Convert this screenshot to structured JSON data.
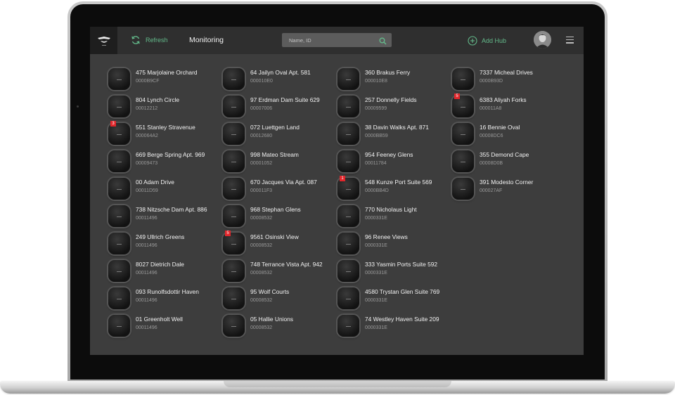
{
  "topbar": {
    "refresh_label": "Refresh",
    "title": "Monitoring",
    "search_placeholder": "Name, ID",
    "add_hub_label": "Add Hub"
  },
  "colors": {
    "accent": "#63b98a",
    "background": "#3d3d3d",
    "topbar": "#2f2f2f",
    "badge": "#e0262b"
  },
  "icons": [
    "logo-icon",
    "refresh-icon",
    "search-icon",
    "add-icon",
    "menu-icon",
    "hub-device-icon"
  ],
  "columns": [
    [
      {
        "name": "475 Marjolaine Orchard",
        "id": "0000B9CF"
      },
      {
        "name": "804 Lynch Circle",
        "id": "00012212"
      },
      {
        "name": "551 Stanley Stravenue",
        "id": "000064A2",
        "badge": "3"
      },
      {
        "name": "669 Berge Spring Apt. 969",
        "id": "00009473"
      },
      {
        "name": "00 Adam Drive",
        "id": "00011D59"
      },
      {
        "name": "738 Nitzsche Dam Apt. 886",
        "id": "00011496"
      },
      {
        "name": "249 Ullrich Greens",
        "id": "00011496"
      },
      {
        "name": "8027 Dietrich Dale",
        "id": "00011496"
      },
      {
        "name": "093 Runolfsdottir Haven",
        "id": "00011496"
      },
      {
        "name": "01 Greenholt Well",
        "id": "00011496"
      }
    ],
    [
      {
        "name": "64 Jailyn Oval Apt. 581",
        "id": "000010E0"
      },
      {
        "name": "97 Erdman Dam Suite 629",
        "id": "00007006"
      },
      {
        "name": "072 Luettgen Land",
        "id": "00012680"
      },
      {
        "name": "998 Mateo Stream",
        "id": "00001052"
      },
      {
        "name": "670 Jacques Via Apt. 087",
        "id": "000011F3"
      },
      {
        "name": "968 Stephan Glens",
        "id": "00008532"
      },
      {
        "name": "9561 Osinski View",
        "id": "00008532",
        "badge": "5"
      },
      {
        "name": "748 Terrance Vista Apt. 942",
        "id": "00008532"
      },
      {
        "name": "95 Wolf Courts",
        "id": "00008532"
      },
      {
        "name": "05 Hallie Unions",
        "id": "00008532"
      }
    ],
    [
      {
        "name": "360 Brakus Ferry",
        "id": "000010E8"
      },
      {
        "name": "257 Donnelly Fields",
        "id": "00009599"
      },
      {
        "name": "38 Davin Walks Apt. 871",
        "id": "0000BB59"
      },
      {
        "name": "954 Feeney Glens",
        "id": "00011784"
      },
      {
        "name": "548 Kunze Port Suite 569",
        "id": "0000BB4D",
        "badge": "1"
      },
      {
        "name": "770 Nicholaus Light",
        "id": "0000331E"
      },
      {
        "name": "96 Renee Views",
        "id": "0000331E"
      },
      {
        "name": "333 Yasmin Ports Suite 592",
        "id": "0000331E"
      },
      {
        "name": "4580 Trystan Glen Suite 769",
        "id": "0000331E"
      },
      {
        "name": "74 Westley Haven Suite 209",
        "id": "0000331E"
      }
    ],
    [
      {
        "name": "7337 Micheal Drives",
        "id": "0000B93D"
      },
      {
        "name": "6383 Aliyah Forks",
        "id": "000011A8",
        "badge": "5"
      },
      {
        "name": "16 Bennie Oval",
        "id": "00008DC6"
      },
      {
        "name": "355 Demond Cape",
        "id": "00008D0B"
      },
      {
        "name": "391 Modesto Corner",
        "id": "000027AF"
      }
    ]
  ]
}
